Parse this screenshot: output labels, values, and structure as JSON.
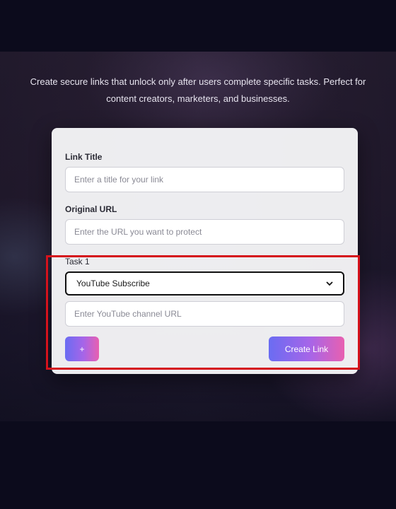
{
  "hero": {
    "subtitle": "Create secure links that unlock only after users complete specific tasks. Perfect for content creators, marketers, and businesses."
  },
  "form": {
    "link_title_label": "Link Title",
    "link_title_placeholder": "Enter a title for your link",
    "original_url_label": "Original URL",
    "original_url_placeholder": "Enter the URL you want to protect",
    "task_label": "Task 1",
    "task_type_selected": "YouTube Subscribe",
    "task_url_placeholder": "Enter YouTube channel URL",
    "add_task_label": "+",
    "create_link_label": "Create Link"
  },
  "colors": {
    "page_bg": "#0c0b1c",
    "button_gradient_start": "#6a6cf2",
    "button_gradient_end": "#e860b0",
    "highlight": "#d5121c"
  }
}
